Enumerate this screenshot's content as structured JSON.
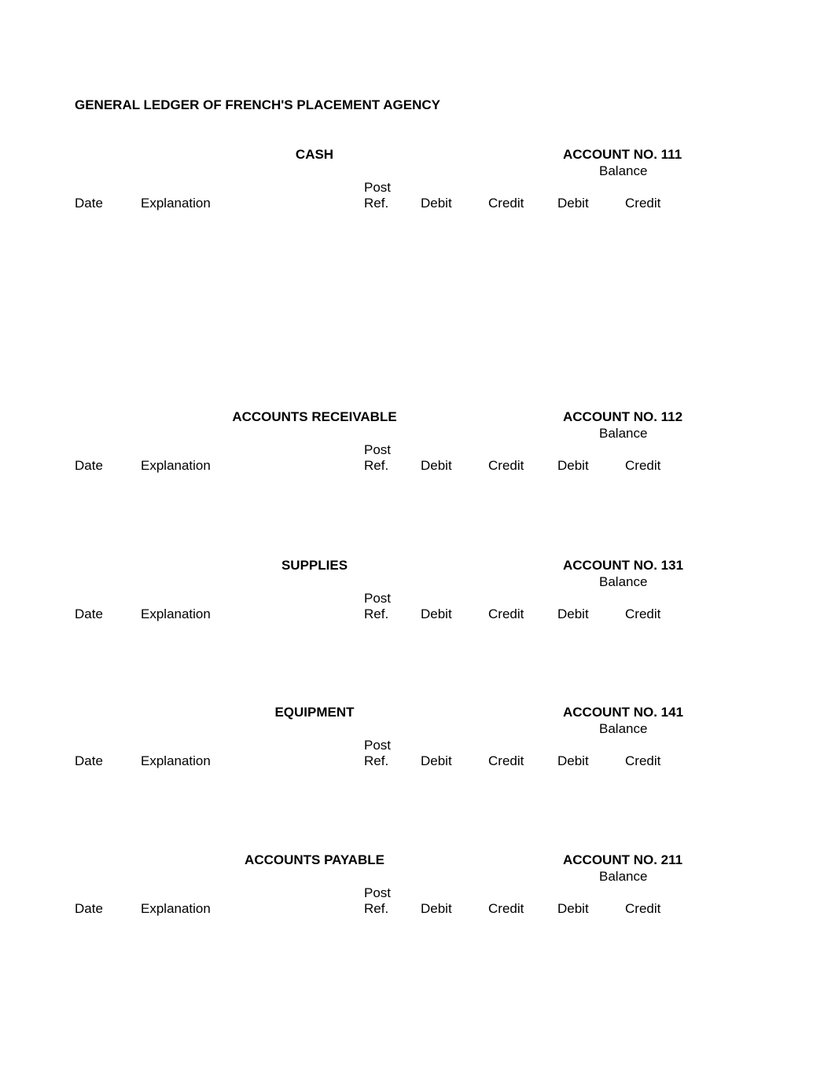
{
  "document": {
    "title": "GENERAL LEDGER OF FRENCH'S PLACEMENT AGENCY"
  },
  "headers": {
    "balance": "Balance",
    "post": "Post",
    "date": "Date",
    "explanation": "Explanation",
    "ref": "Ref.",
    "debit": "Debit",
    "credit": "Credit",
    "balance_debit": "Debit",
    "balance_credit": "Credit"
  },
  "accounts": [
    {
      "name": "CASH",
      "number_label": "ACCOUNT NO. 111",
      "entries": []
    },
    {
      "name": "ACCOUNTS RECEIVABLE",
      "number_label": "ACCOUNT NO. 112",
      "entries": []
    },
    {
      "name": "SUPPLIES",
      "number_label": "ACCOUNT NO. 131",
      "entries": []
    },
    {
      "name": "EQUIPMENT",
      "number_label": "ACCOUNT NO. 141",
      "entries": []
    },
    {
      "name": "ACCOUNTS PAYABLE",
      "number_label": "ACCOUNT NO. 211",
      "entries": []
    }
  ]
}
